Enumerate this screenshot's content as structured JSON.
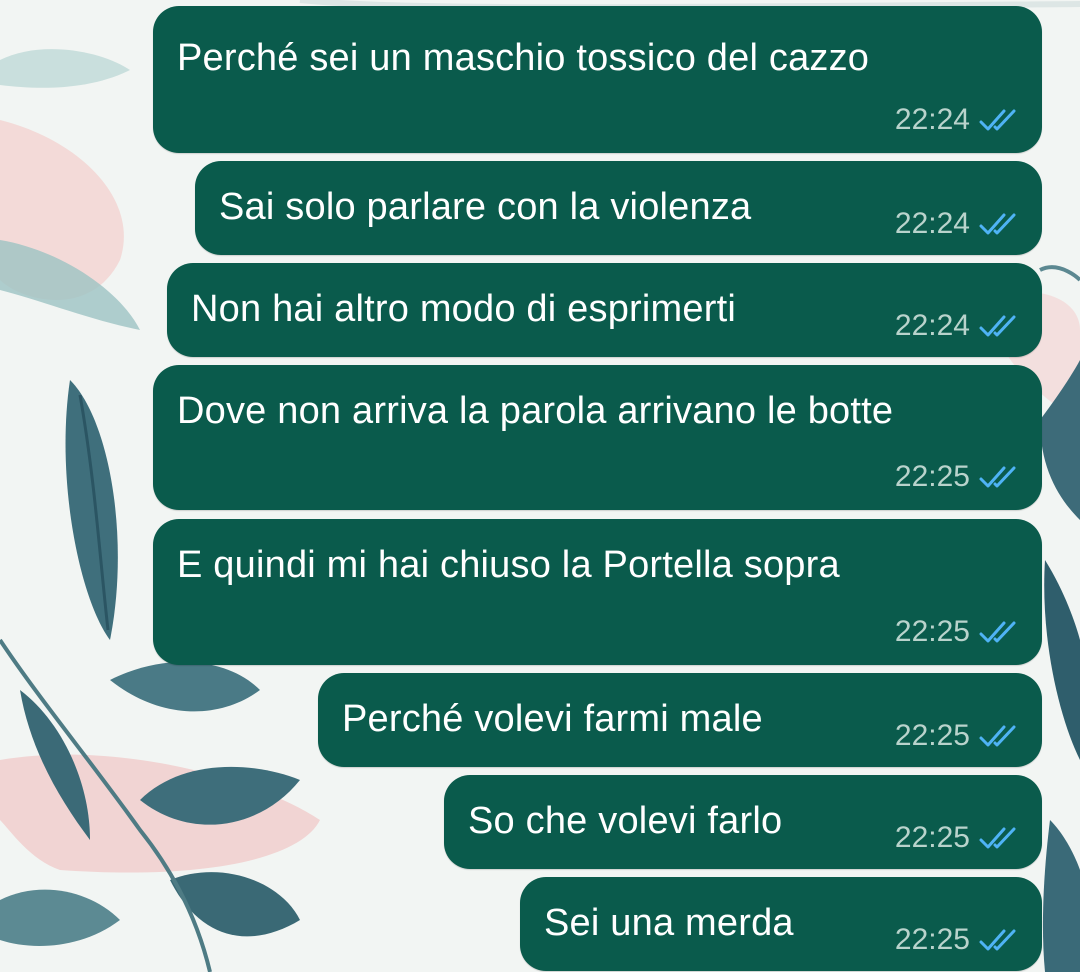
{
  "colors": {
    "bubble_outgoing": "#0a5b4c",
    "text": "#ffffff",
    "time": "#b9d3cc",
    "read_ticks": "#4fb3f5"
  },
  "messages": [
    {
      "text": "Perché sei un maschio tossico del cazzo",
      "time": "22:24",
      "status": "read",
      "status_icon": "double-check-icon"
    },
    {
      "text": "Sai solo parlare con la violenza",
      "time": "22:24",
      "status": "read",
      "status_icon": "double-check-icon"
    },
    {
      "text": "Non hai altro modo di esprimerti",
      "time": "22:24",
      "status": "read",
      "status_icon": "double-check-icon"
    },
    {
      "text": "Dove non arriva la parola arrivano le botte",
      "time": "22:25",
      "status": "read",
      "status_icon": "double-check-icon"
    },
    {
      "text": "E quindi mi hai chiuso la Portella sopra",
      "time": "22:25",
      "status": "read",
      "status_icon": "double-check-icon"
    },
    {
      "text": "Perché volevi farmi male",
      "time": "22:25",
      "status": "read",
      "status_icon": "double-check-icon"
    },
    {
      "text": "So che volevi farlo",
      "time": "22:25",
      "status": "read",
      "status_icon": "double-check-icon"
    },
    {
      "text": "Sei una merda",
      "time": "22:25",
      "status": "read",
      "status_icon": "double-check-icon"
    }
  ]
}
